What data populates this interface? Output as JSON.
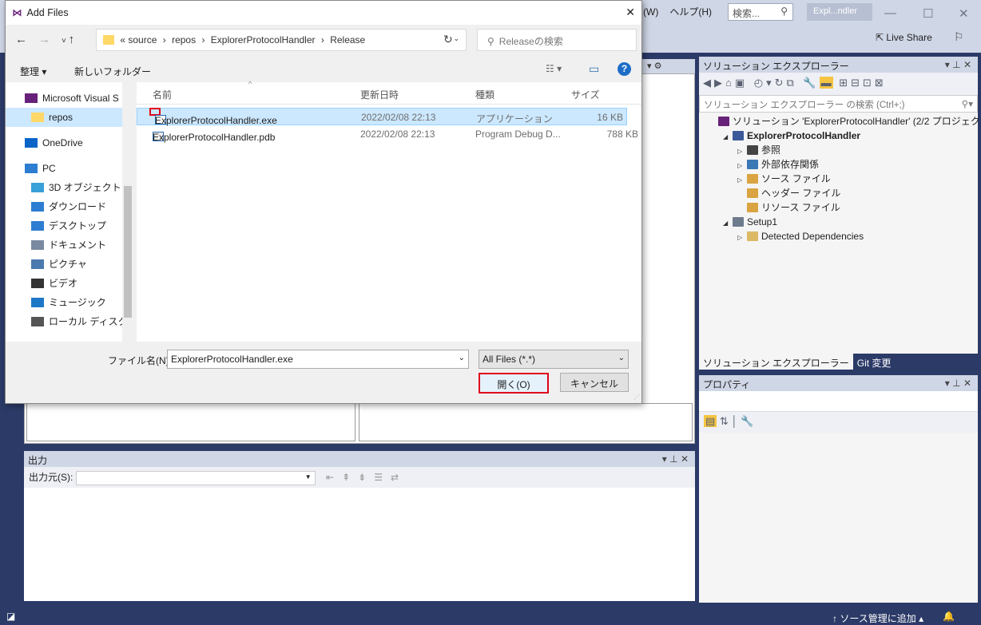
{
  "vs": {
    "menu": [
      "(W)",
      "ヘルプ(H)"
    ],
    "search_placeholder": "検索...",
    "title": "Expl...ndler",
    "live_share": "Live Share",
    "output": {
      "title": "出力",
      "source_label": "出力元(S):",
      "source_value": ""
    },
    "solution_explorer": {
      "title": "ソリューション エクスプローラー",
      "search_placeholder": "ソリューション エクスプローラー の検索 (Ctrl+;)",
      "tree": [
        {
          "label": "ソリューション 'ExplorerProtocolHandler' (2/2 プロジェクト)",
          "level": 0,
          "expander": "",
          "icon_color": "#68217a"
        },
        {
          "label": "ExplorerProtocolHandler",
          "level": 1,
          "expander": "◢",
          "icon_color": "#3c5a99",
          "bold": true
        },
        {
          "label": "参照",
          "level": 2,
          "expander": "▷",
          "icon_color": "#444"
        },
        {
          "label": "外部依存関係",
          "level": 2,
          "expander": "▷",
          "icon_color": "#3c78b4"
        },
        {
          "label": "ソース ファイル",
          "level": 2,
          "expander": "▷",
          "icon_color": "#d9a441"
        },
        {
          "label": "ヘッダー ファイル",
          "level": 2,
          "expander": "",
          "icon_color": "#d9a441"
        },
        {
          "label": "リソース ファイル",
          "level": 2,
          "expander": "",
          "icon_color": "#d9a441"
        },
        {
          "label": "Setup1",
          "level": 1,
          "expander": "◢",
          "icon_color": "#6d7b8d"
        },
        {
          "label": "Detected Dependencies",
          "level": 2,
          "expander": "▷",
          "icon_color": "#dcb967"
        }
      ],
      "tabs": [
        "ソリューション エクスプローラー",
        "Git 変更"
      ]
    },
    "properties": {
      "title": "プロパティ"
    },
    "status": {
      "source_control": "ソース管理に追加"
    }
  },
  "dialog": {
    "title": "Add Files",
    "address": {
      "chevron": "«",
      "crumbs": [
        "source",
        "repos",
        "ExplorerProtocolHandler",
        "Release"
      ]
    },
    "search_placeholder": "Releaseの検索",
    "organize": "整理",
    "new_folder": "新しいフォルダー",
    "nav": [
      {
        "label": "Microsoft Visual S",
        "icon": "vs-icon",
        "color": "#68217a",
        "indent": 0
      },
      {
        "label": "repos",
        "icon": "folder-icon",
        "color": "#ffd867",
        "indent": 1,
        "selected": true
      },
      {
        "label": "OneDrive",
        "icon": "onedrive-icon",
        "color": "#0a64c8",
        "indent": 0
      },
      {
        "label": "PC",
        "icon": "pc-icon",
        "color": "#2d7dd2",
        "indent": 0
      },
      {
        "label": "3D オブジェクト",
        "icon": "cube-icon",
        "color": "#3aa0d8",
        "indent": 1
      },
      {
        "label": "ダウンロード",
        "icon": "download-icon",
        "color": "#2d7dd2",
        "indent": 1
      },
      {
        "label": "デスクトップ",
        "icon": "desktop-icon",
        "color": "#2d7dd2",
        "indent": 1
      },
      {
        "label": "ドキュメント",
        "icon": "document-icon",
        "color": "#7a8aa0",
        "indent": 1
      },
      {
        "label": "ピクチャ",
        "icon": "picture-icon",
        "color": "#4a7ab0",
        "indent": 1
      },
      {
        "label": "ビデオ",
        "icon": "video-icon",
        "color": "#333",
        "indent": 1
      },
      {
        "label": "ミュージック",
        "icon": "music-icon",
        "color": "#1e78c8",
        "indent": 1
      },
      {
        "label": "ローカル ディスク (C",
        "icon": "disk-icon",
        "color": "#555",
        "indent": 1
      }
    ],
    "columns": {
      "name": "名前",
      "date": "更新日時",
      "type": "種類",
      "size": "サイズ"
    },
    "files": [
      {
        "name": "ExplorerProtocolHandler.exe",
        "date": "2022/02/08 22:13",
        "type": "アプリケーション",
        "size": "16 KB",
        "selected": true
      },
      {
        "name": "ExplorerProtocolHandler.pdb",
        "date": "2022/02/08 22:13",
        "type": "Program Debug D...",
        "size": "788 KB"
      }
    ],
    "filename_label": "ファイル名(N):",
    "filename_value": "ExplorerProtocolHandler.exe",
    "filter": "All Files (*.*)",
    "open_button": "開く(O)",
    "cancel_button": "キャンセル"
  }
}
